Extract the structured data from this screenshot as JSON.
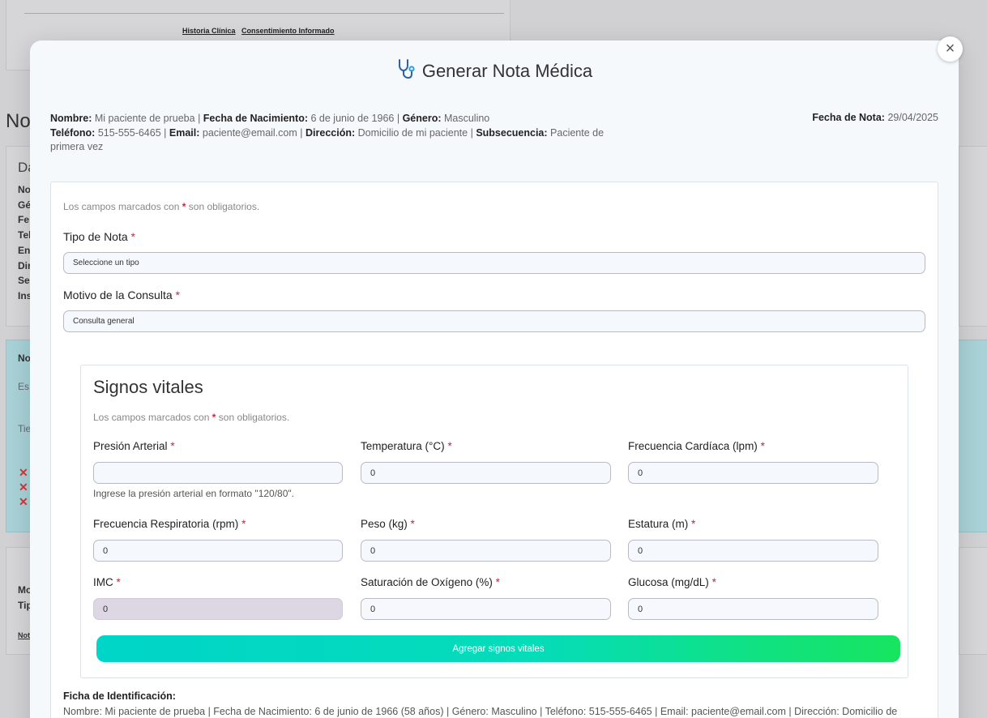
{
  "background": {
    "links": [
      "Historia Clínica",
      "Consentimiento Informado"
    ],
    "title_fragment": "Not",
    "section_fragment": "Da",
    "row_fragments": [
      "No",
      "Gé",
      "Fe",
      "Tel",
      "En",
      "Dir",
      "Se",
      "Ins"
    ],
    "teal_fragments": [
      "No",
      "Es",
      "Tie"
    ],
    "bottom_fragments": [
      "Mo",
      "Tip",
      "Not"
    ]
  },
  "modal": {
    "title": "Generar Nota Médica",
    "icon": "stethoscope-icon",
    "close_label": "×"
  },
  "patient": {
    "name_label": "Nombre:",
    "name": "Mi paciente de prueba",
    "birth_label": "Fecha de Nacimiento:",
    "birth": "6 de junio de 1966",
    "gender_label": "Género:",
    "gender": "Masculino",
    "phone_label": "Teléfono:",
    "phone": "515-555-6465",
    "email_label": "Email:",
    "email": "paciente@email.com",
    "address_label": "Dirección:",
    "address": "Domicilio de mi paciente",
    "subsequence_label": "Subsecuencia:",
    "subsequence": "Paciente de primera vez",
    "note_date_label": "Fecha de Nota:",
    "note_date": "29/04/2025"
  },
  "form": {
    "required_note_pre": "Los campos marcados con",
    "required_star": "*",
    "required_note_post": "son obligatorios.",
    "note_type_label": "Tipo de Nota",
    "note_type_value": "Seleccione un tipo",
    "reason_label": "Motivo de la Consulta",
    "reason_value": "Consulta general"
  },
  "vitals": {
    "title": "Signos vitales",
    "required_note_pre": "Los campos marcados con",
    "required_note_post": "son obligatorios.",
    "pressure_label": "Presión Arterial",
    "pressure_value": "",
    "pressure_help": "Ingrese la presión arterial en formato \"120/80\".",
    "temperature_label": "Temperatura (°C)",
    "temperature_value": "0",
    "heart_rate_label": "Frecuencia Cardíaca (lpm)",
    "heart_rate_value": "0",
    "resp_rate_label": "Frecuencia Respiratoria (rpm)",
    "resp_rate_value": "0",
    "weight_label": "Peso (kg)",
    "weight_value": "0",
    "height_label": "Estatura (m)",
    "height_value": "0",
    "bmi_label": "IMC",
    "bmi_value": "0",
    "oxygen_label": "Saturación de Oxígeno (%)",
    "oxygen_value": "0",
    "glucose_label": "Glucosa (mg/dL)",
    "glucose_value": "0",
    "add_button": "Agregar signos vitales"
  },
  "ficha": {
    "title": "Ficha de Identificación:",
    "text": "Nombre: Mi paciente de prueba | Fecha de Nacimiento: 6 de junio de 1966 (58 años) | Género: Masculino | Teléfono: 515-555-6465 | Email: paciente@email.com | Dirección: Domicilio de"
  },
  "colors": {
    "accent_start": "#00d5c9",
    "accent_end": "#17e55f",
    "required": "#d0213c"
  }
}
